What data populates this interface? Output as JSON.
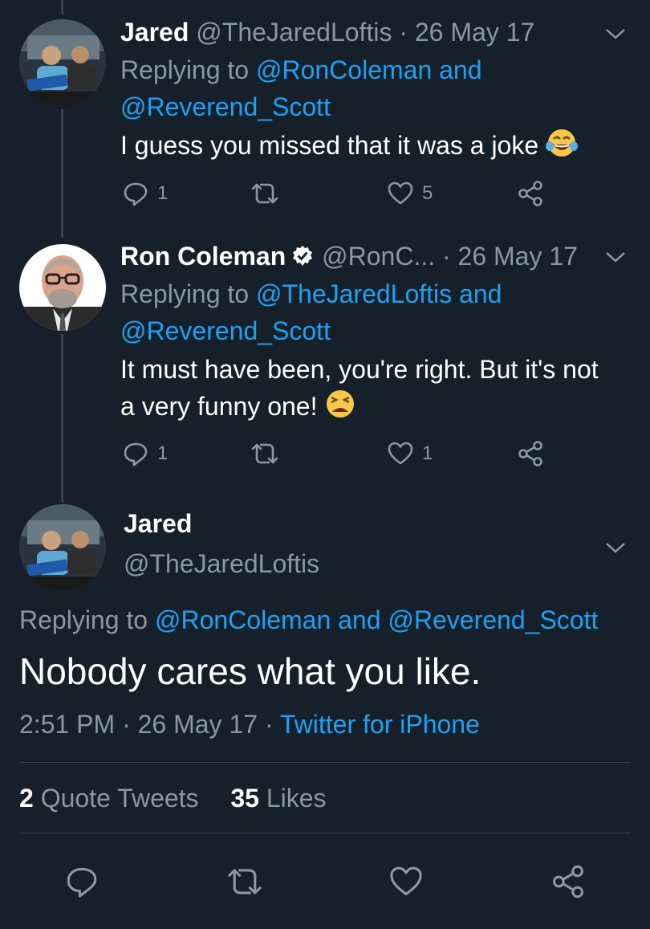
{
  "tweets": [
    {
      "name": "Jared",
      "handle": "@TheJaredLoftis",
      "date": "· 26 May 17",
      "replying_prefix": "Replying to ",
      "replying_to_1": "@RonColeman",
      "replying_and": " and",
      "replying_to_2": "@Reverend_Scott",
      "text": "I guess you missed that it was a joke",
      "emoji": "tears-of-joy-emoji",
      "replies": "1",
      "retweets": "",
      "likes": "5"
    },
    {
      "name": "Ron Coleman",
      "verified": true,
      "handle": "@RonC...",
      "date": "· 26 May 17",
      "replying_prefix": "Replying to ",
      "replying_to_1": "@TheJaredLoftis",
      "replying_and": " and",
      "replying_to_2": "@Reverend_Scott",
      "text_line1": "It must have been, you're right. But it's not",
      "text_line2": "a very funny one!",
      "emoji": "tired-face-emoji",
      "replies": "1",
      "retweets": "",
      "likes": "1"
    }
  ],
  "main_tweet": {
    "name": "Jared",
    "handle": "@TheJaredLoftis",
    "replying_prefix": "Replying to ",
    "replying_to_1": "@RonColeman",
    "replying_and": " and ",
    "replying_to_2": "@Reverend_Scott",
    "text": "Nobody cares what you like.",
    "time": "2:51 PM",
    "date": " · 26 May 17 · ",
    "source": "Twitter for iPhone",
    "quote_tweets_count": "2",
    "quote_tweets_label": " Quote Tweets",
    "likes_count": "35",
    "likes_label": " Likes"
  },
  "colors": {
    "background": "#15202b",
    "text": "#ffffff",
    "muted": "#8899a6",
    "link": "#1da1f2",
    "divider": "#38444d"
  },
  "icons": [
    "reply-icon",
    "retweet-icon",
    "like-icon",
    "share-icon",
    "chevron-down-icon",
    "verified-badge-icon"
  ]
}
